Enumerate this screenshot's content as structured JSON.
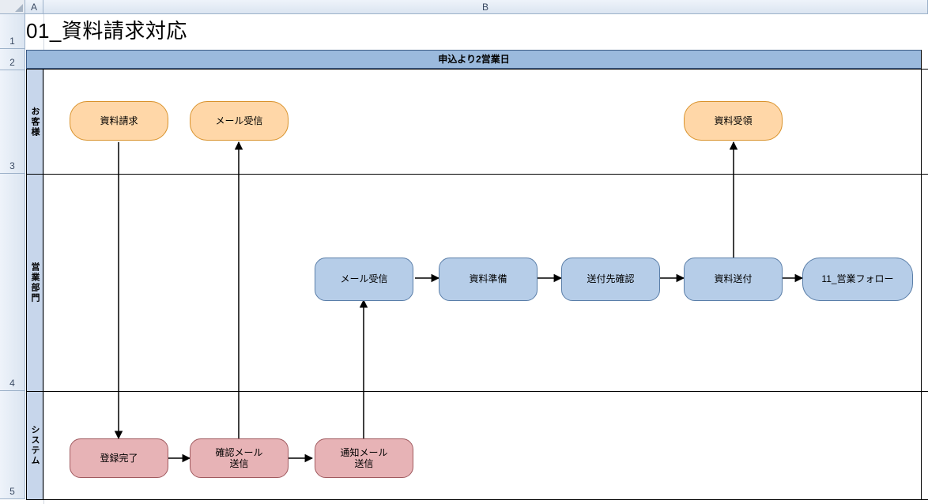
{
  "spreadsheet": {
    "columns": {
      "A": "A",
      "B": "B"
    },
    "rows": {
      "r1": "1",
      "r2": "2",
      "r3": "3",
      "r4": "4",
      "r5": "5"
    }
  },
  "title": "01_資料請求対応",
  "timeline_label": "申込より2営業日",
  "lanes": {
    "customer": "お客様",
    "sales": "営業部門",
    "system": "システム"
  },
  "nodes": {
    "cust_request": "資料請求",
    "cust_mail_recv": "メール受信",
    "cust_doc_recv": "資料受領",
    "sales_mail_recv": "メール受信",
    "sales_prep": "資料準備",
    "sales_addr_check": "送付先確認",
    "sales_send": "資料送付",
    "sales_follow": "11_営業フォロー",
    "sys_reg_done": "登録完了",
    "sys_conf_mail": "確認メール\n送信",
    "sys_notify_mail": "通知メール\n送信"
  }
}
